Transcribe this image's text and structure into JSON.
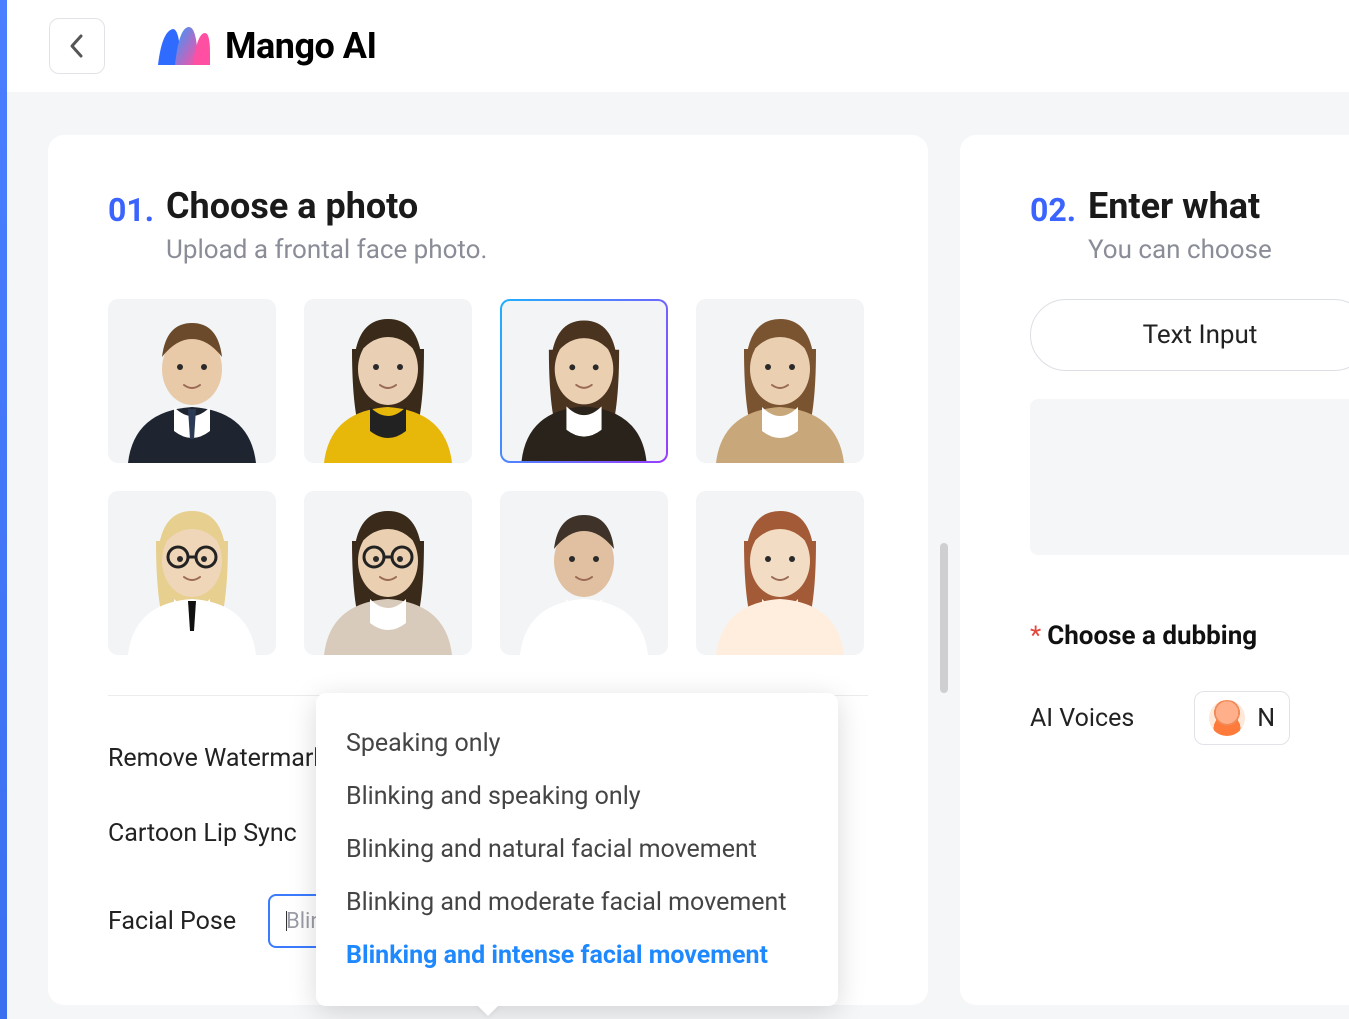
{
  "brand": {
    "name": "Mango AI"
  },
  "step1": {
    "num": "01.",
    "title": "Choose a photo",
    "subtitle": "Upload a frontal face photo.",
    "photos": [
      {
        "suit": "#1e2430",
        "shirt": "#fff",
        "tie": "#2b3a55",
        "hair": "#6a4a2a",
        "face": "#e8c9a8",
        "sex": "m",
        "glasses": false
      },
      {
        "suit": "#e7b70a",
        "shirt": "#222",
        "tie": "",
        "hair": "#3a2a1a",
        "face": "#e9cfb3",
        "sex": "f",
        "glasses": false
      },
      {
        "suit": "#2a231b",
        "shirt": "#fff",
        "tie": "",
        "hair": "#4a331f",
        "face": "#eacfb1",
        "sex": "f",
        "glasses": false,
        "selected": true
      },
      {
        "suit": "#c8a77a",
        "shirt": "#fff",
        "tie": "",
        "hair": "#7a5330",
        "face": "#eacfb1",
        "sex": "f",
        "glasses": false
      },
      {
        "suit": "#fff",
        "shirt": "#fff",
        "tie": "#111",
        "hair": "#e7cf8f",
        "face": "#f0d6b8",
        "sex": "f",
        "glasses": true
      },
      {
        "suit": "#d9cbbb",
        "shirt": "#fff",
        "tie": "",
        "hair": "#3a2a1a",
        "face": "#eacfb1",
        "sex": "f",
        "glasses": true
      },
      {
        "suit": "#fff",
        "shirt": "#fff",
        "tie": "",
        "hair": "#3f3329",
        "face": "#e0c0a0",
        "sex": "m",
        "glasses": false
      },
      {
        "suit": "#ffeede",
        "shirt": "#ffeede",
        "tie": "",
        "hair": "#a35a36",
        "face": "#f3dcc4",
        "sex": "f",
        "glasses": false
      }
    ],
    "options": {
      "remove_watermark_label": "Remove Watermark",
      "cartoon_lip_label": "Cartoon Lip Sync",
      "facial_pose_label": "Facial Pose",
      "facial_pose_value": "Blinking and intense facial movement",
      "facial_pose_options": [
        "Speaking only",
        "Blinking and speaking only",
        "Blinking and natural facial movement",
        "Blinking and moderate facial movement",
        "Blinking and intense facial movement"
      ],
      "facial_pose_selected_index": 4
    }
  },
  "step2": {
    "num": "02.",
    "title": "Enter what",
    "subtitle": "You can choose",
    "tab_label": "Text Input",
    "dubbing_label": "Choose a dubbing",
    "voices_label": "AI Voices",
    "voice_name_initial": "N"
  }
}
